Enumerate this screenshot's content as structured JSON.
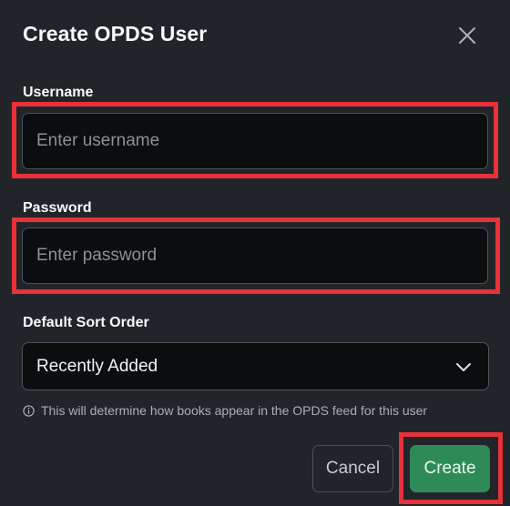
{
  "dialog": {
    "title": "Create OPDS User",
    "close_icon": "close-icon"
  },
  "username": {
    "label": "Username",
    "value": "",
    "placeholder": "Enter username"
  },
  "password": {
    "label": "Password",
    "value": "",
    "placeholder": "Enter password"
  },
  "sort_order": {
    "label": "Default Sort Order",
    "selected": "Recently Added",
    "icon": "chevron-down-icon",
    "hint": "This will determine how books appear in the OPDS feed for this user",
    "hint_icon": "info-icon"
  },
  "actions": {
    "cancel_label": "Cancel",
    "create_label": "Create"
  },
  "colors": {
    "background": "#212529",
    "highlight": "#e8313a",
    "primary": "#2e8b57"
  }
}
